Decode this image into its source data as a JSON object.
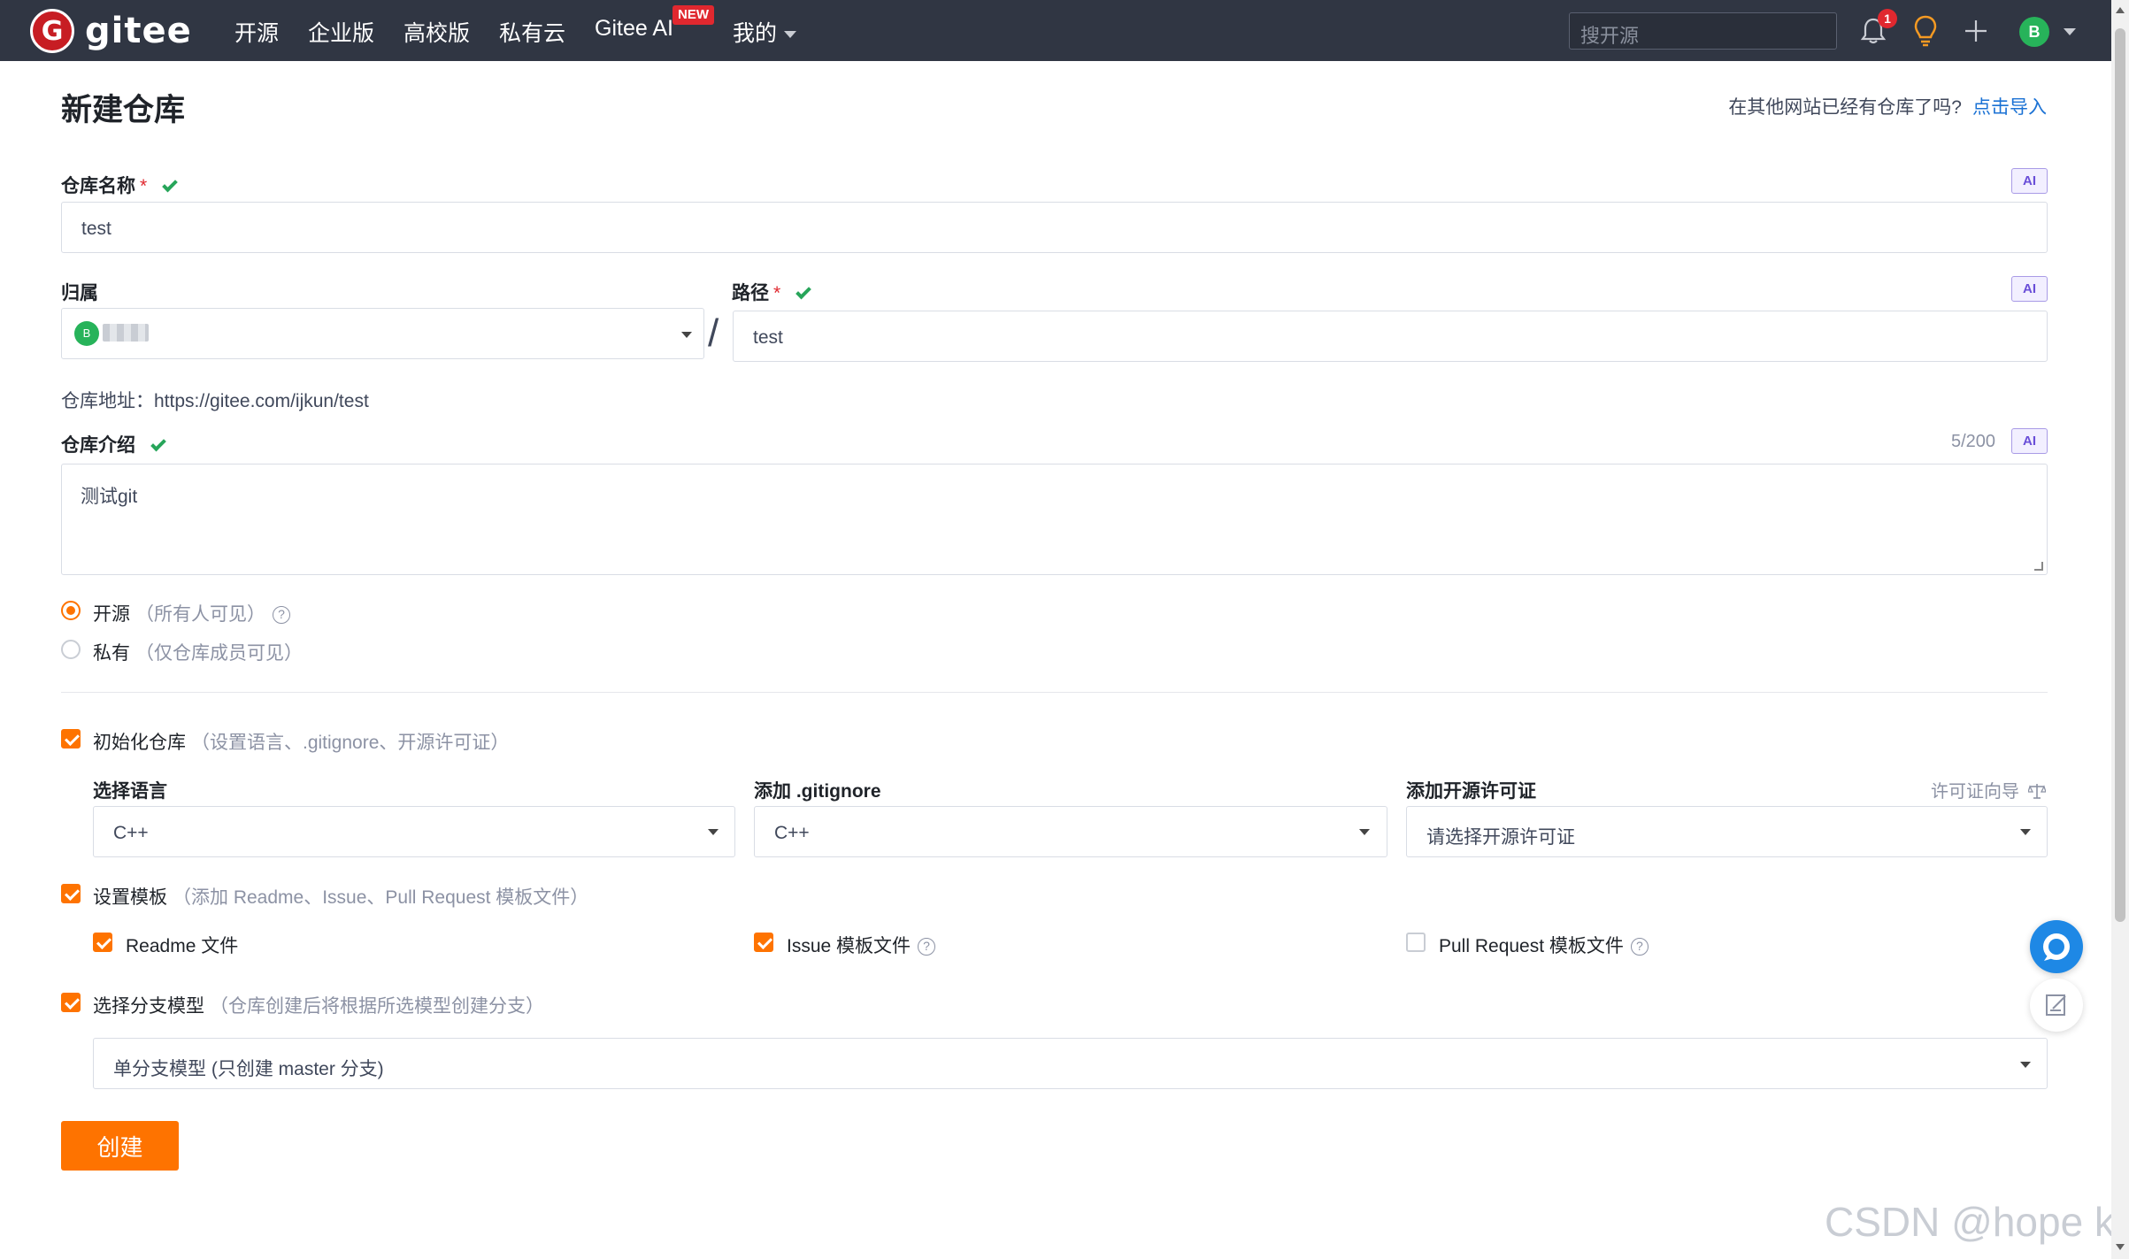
{
  "nav": {
    "logo_letter": "G",
    "logo_text": "gitee",
    "items": [
      "开源",
      "企业版",
      "高校版",
      "私有云",
      "Gitee AI",
      "我的"
    ],
    "new_badge": "NEW",
    "search_placeholder": "搜开源",
    "notification_count": "1",
    "avatar_letter": "B"
  },
  "page": {
    "title": "新建仓库",
    "import_tip": "在其他网站已经有仓库了吗?",
    "import_link": "点击导入"
  },
  "form": {
    "repo_name_label": "仓库名称",
    "required_mark": "*",
    "repo_name_value": "test",
    "ai_label": "AI",
    "owner_label": "归属",
    "owner_avatar_letter": "B",
    "path_label": "路径",
    "path_value": "test",
    "separator": "/",
    "repo_address": "仓库地址：https://gitee.com/ijkun/test",
    "desc_label": "仓库介绍",
    "desc_counter": "5/200",
    "desc_value": "测试git",
    "visibility": {
      "public_label": "开源",
      "public_hint": "（所有人可见）",
      "private_label": "私有",
      "private_hint": "（仅仓库成员可见）",
      "selected": "public"
    },
    "help_glyph": "?",
    "init": {
      "label": "初始化仓库",
      "hint": "（设置语言、.gitignore、开源许可证）",
      "checked": true,
      "language_label": "选择语言",
      "language_value": "C++",
      "gitignore_label": "添加 .gitignore",
      "gitignore_value": "C++",
      "license_label": "添加开源许可证",
      "license_guide": "许可证向导",
      "license_placeholder": "请选择开源许可证"
    },
    "template": {
      "label": "设置模板",
      "hint": "（添加 Readme、Issue、Pull Request 模板文件）",
      "checked": true,
      "readme_label": "Readme 文件",
      "readme_checked": true,
      "issue_label": "Issue 模板文件",
      "issue_checked": true,
      "pr_label": "Pull Request 模板文件",
      "pr_checked": false
    },
    "branch": {
      "label": "选择分支模型",
      "hint": "（仓库创建后将根据所选模型创建分支）",
      "checked": true,
      "model_value": "单分支模型 (只创建 master 分支)"
    },
    "submit_label": "创建"
  },
  "watermark": "CSDN @hope kc",
  "colors": {
    "nav_bg": "#303643",
    "accent": "#fe7300",
    "link": "#1a71d4",
    "valid": "#27a55a",
    "brand_red": "#c71d23"
  }
}
